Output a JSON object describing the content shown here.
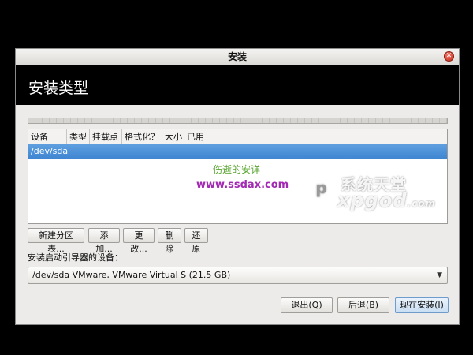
{
  "window": {
    "title": "安装",
    "close_icon": "close-icon"
  },
  "header": {
    "title": "安装类型"
  },
  "table": {
    "columns": [
      "设备",
      "类型",
      "挂载点",
      "格式化？",
      "大小",
      "已用"
    ],
    "rows": [
      {
        "device": "/dev/sda"
      }
    ]
  },
  "partition_buttons": {
    "new_table": "新建分区表...",
    "add": "添加...",
    "change": "更改...",
    "delete": "删除",
    "revert": "还原"
  },
  "bootloader": {
    "label": "安装启动引导器的设备：",
    "selected": "/dev/sda  VMware, VMware Virtual S (21.5 GB)"
  },
  "actions": {
    "quit": "退出(Q)",
    "back": "后退(B)",
    "install_now": "现在安装(I)"
  },
  "watermarks": {
    "cn_text": "伤逝的安详",
    "url": "www.ssdax.com",
    "brand_line1": "系统天堂",
    "brand_line2": "xpgod",
    "brand_suffix": ".com"
  },
  "colors": {
    "selection": "#3f86d2",
    "header_background": "#000000",
    "primary_button_border": "#6d9bcc"
  }
}
